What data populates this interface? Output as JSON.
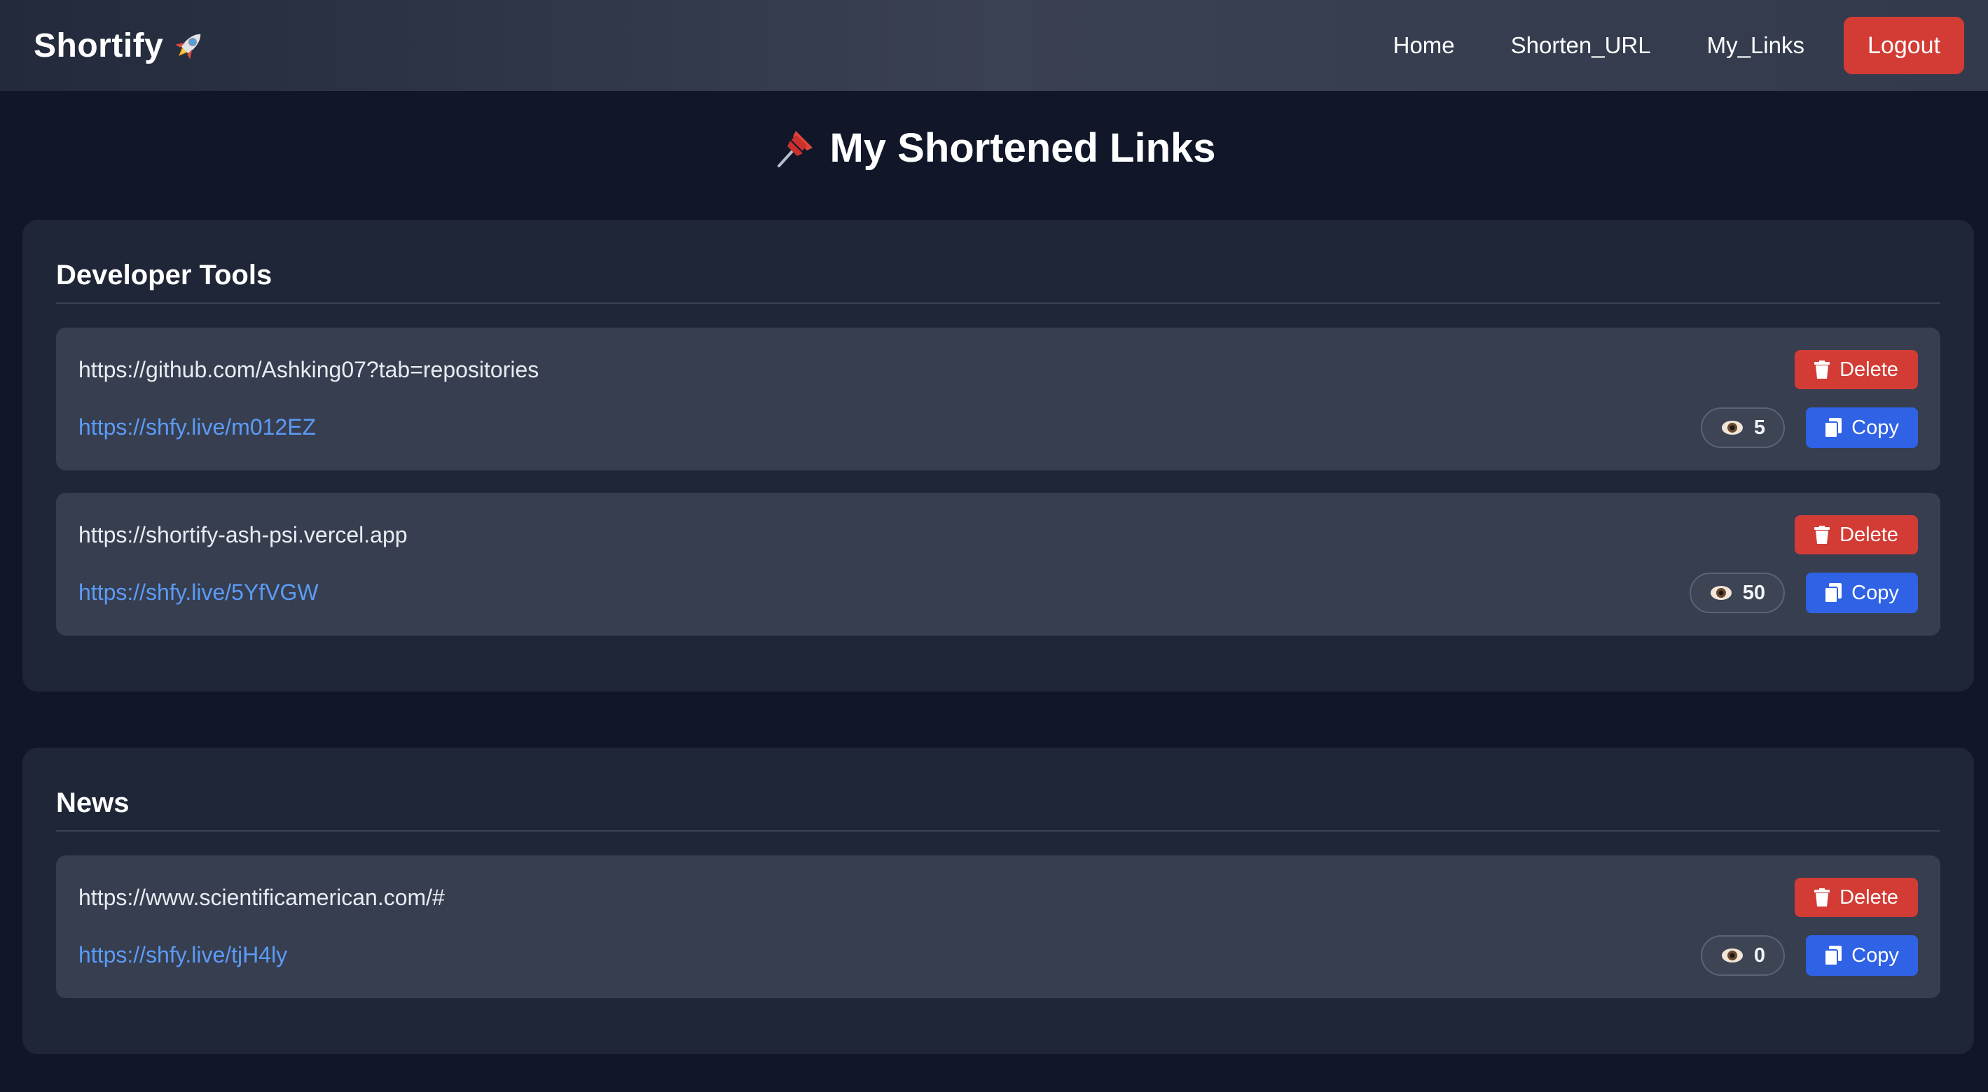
{
  "app": {
    "title": "Shortify"
  },
  "nav": {
    "home": "Home",
    "shorten": "Shorten_URL",
    "my_links": "My_Links",
    "logout": "Logout"
  },
  "page": {
    "title": "My Shortened Links"
  },
  "groups": [
    {
      "title": "Developer Tools",
      "links": [
        {
          "original": "https://github.com/Ashking07?tab=repositories",
          "short": "https://shfy.live/m012EZ",
          "views": "5",
          "delete_label": "Delete",
          "copy_label": "Copy"
        },
        {
          "original": "https://shortify-ash-psi.vercel.app",
          "short": "https://shfy.live/5YfVGW",
          "views": "50",
          "delete_label": "Delete",
          "copy_label": "Copy"
        }
      ]
    },
    {
      "title": "News",
      "links": [
        {
          "original": "https://www.scientificamerican.com/#",
          "short": "https://shfy.live/tjH4ly",
          "views": "0",
          "delete_label": "Delete",
          "copy_label": "Copy"
        }
      ]
    }
  ],
  "colors": {
    "background": "#111729",
    "card": "#1f2637",
    "link_card": "#363e50",
    "delete": "#d23c35",
    "copy": "#2f62e4",
    "short_link": "#5c9bf5"
  },
  "icons": {
    "brand": "rocket-icon",
    "title": "pushpin-icon",
    "delete": "trash-icon",
    "copy": "copy-icon",
    "views": "eye-icon"
  }
}
